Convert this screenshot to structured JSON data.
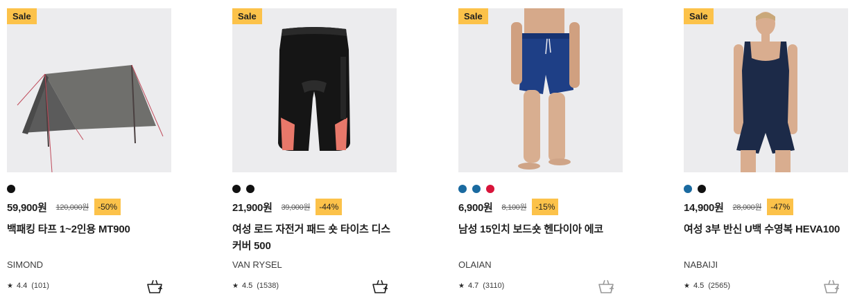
{
  "products": [
    {
      "sale_label": "Sale",
      "image_icon": "tent-tarp-image",
      "colors": [
        "#111111"
      ],
      "price": "59,900원",
      "original_price": "120,000원",
      "discount": "-50%",
      "title": "백패킹 타프 1~2인용 MT900",
      "brand": "SIMOND",
      "rating": "4.4",
      "review_count": "(101)",
      "cart_icon": "add-to-cart-icon"
    },
    {
      "sale_label": "Sale",
      "image_icon": "cycling-shorts-image",
      "colors": [
        "#111111",
        "#111111"
      ],
      "price": "21,900원",
      "original_price": "39,000원",
      "discount": "-44%",
      "title": "여성 로드 자전거 패드 숏 타이츠 디스 커버 500",
      "brand": "VAN RYSEL",
      "rating": "4.5",
      "review_count": "(1538)",
      "cart_icon": "add-to-cart-icon"
    },
    {
      "sale_label": "Sale",
      "image_icon": "swim-shorts-image",
      "colors": [
        "#1a6aa0",
        "#1a6aa0",
        "#d8143a"
      ],
      "price": "6,900원",
      "original_price": "8,100원",
      "discount": "-15%",
      "title": "남성 15인치 보드숏 헨다이아 에코",
      "brand": "OLAIAN",
      "rating": "4.7",
      "review_count": "(3110)",
      "cart_icon": "add-to-cart-icon"
    },
    {
      "sale_label": "Sale",
      "image_icon": "swimsuit-image",
      "colors": [
        "#1a6aa0",
        "#111111"
      ],
      "price": "14,900원",
      "original_price": "28,000원",
      "discount": "-47%",
      "title": "여성 3부 반신 U백 수영복 HEVA100",
      "brand": "NABAIJI",
      "rating": "4.5",
      "review_count": "(2565)",
      "cart_icon": "add-to-cart-icon"
    }
  ],
  "star_icon": "★"
}
